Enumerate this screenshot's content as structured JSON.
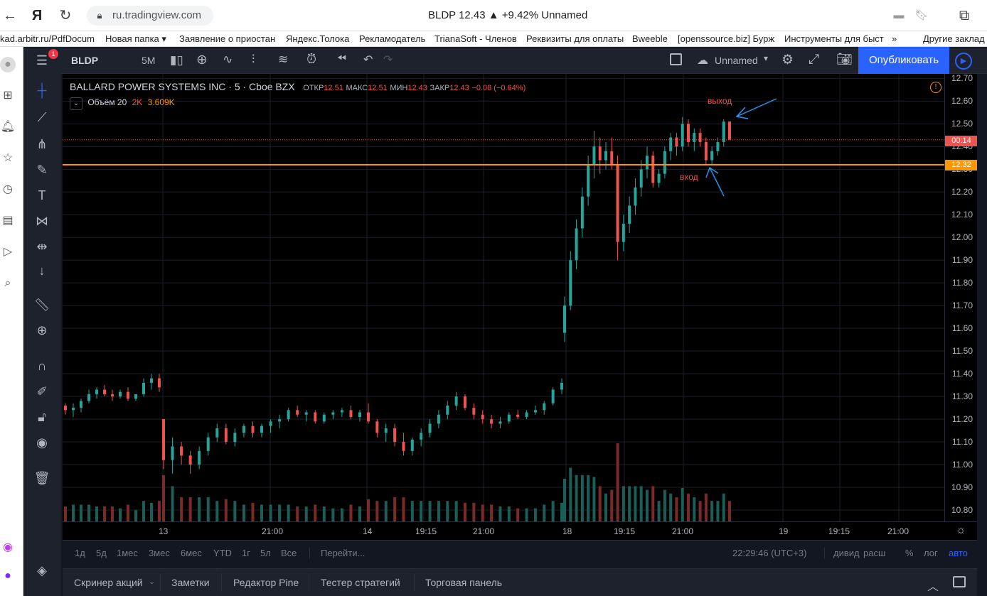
{
  "browser": {
    "url": "ru.tradingview.com",
    "title": "BLDP 12.43 ▲ +9.42% Unnamed",
    "bookmarks": [
      "kad.arbitr.ru/PdfDocum",
      "Новая папка ▾",
      "Заявление о приостан",
      "Яндекс.Толока",
      "Рекламодатель",
      "TrianaSoft - Членов",
      "Реквизиты для оплаты",
      "Bweeble",
      "[openssource.biz] Бурж",
      "Инструменты для быст",
      "»",
      "Другие заклад"
    ]
  },
  "toolbar": {
    "symbol": "BLDP",
    "interval": "5M",
    "layout_name": "Unnamed",
    "publish_label": "Опубликовать",
    "notification_count": "1"
  },
  "legend": {
    "name": "BALLARD POWER SYSTEMS INC · 5 · Cboe BZX",
    "open_label": "ОТКР",
    "open": "12.51",
    "high_label": "МАКС",
    "high": "12.51",
    "low_label": "МИН",
    "low": "12.43",
    "close_label": "ЗАКР",
    "close": "12.43",
    "change": "−0.08 (−0.64%)",
    "volume_label": "Объём 20",
    "volume_a": "2K",
    "volume_b": "3.609K"
  },
  "annotations": {
    "exit": "выход",
    "entry": "вход"
  },
  "price_axis": {
    "labels": [
      "12.70",
      "12.60",
      "12.50",
      "12.40",
      "12.30",
      "12.20",
      "12.10",
      "12.00",
      "11.90",
      "11.80",
      "11.70",
      "11.60",
      "11.50",
      "11.40",
      "11.30",
      "11.20",
      "11.10",
      "11.00",
      "10.90",
      "10.80"
    ],
    "current_price_tag": "00:14",
    "level_tag": "12.32"
  },
  "time_axis": {
    "labels": [
      "13",
      "21:00",
      "14",
      "19:15",
      "21:00",
      "18",
      "19:15",
      "21:00",
      "19",
      "19:15",
      "21:00"
    ]
  },
  "bottom_bar": {
    "ranges": [
      "1д",
      "5д",
      "1мес",
      "3мес",
      "6мес",
      "YTD",
      "1г",
      "5л",
      "Все"
    ],
    "goto": "Перейти...",
    "clock": "22:29:46 (UTC+3)",
    "options": [
      "дивид",
      "расш",
      "%",
      "лог",
      "авто"
    ]
  },
  "panel_tabs": [
    "Скринер акций",
    "Заметки",
    "Редактор Pine",
    "Тестер стратегий",
    "Торговая панель"
  ],
  "colors": {
    "up": "#26a69a",
    "down": "#ef5350",
    "level": "#ff9800",
    "accent": "#2962ff",
    "arrow": "#2196f3"
  },
  "chart_data": {
    "type": "candlestick",
    "title": "BALLARD POWER SYSTEMS INC · 5 · Cboe BZX",
    "ylim": [
      10.75,
      12.72
    ],
    "x_ticks": [
      "13",
      "21:00",
      "14",
      "19:15",
      "21:00",
      "18",
      "19:15",
      "21:00",
      "19",
      "19:15",
      "21:00"
    ],
    "horizontal_level": 12.32,
    "last_price": 12.43,
    "ohlc": [
      [
        11.26,
        11.27,
        11.22,
        11.24
      ],
      [
        11.24,
        11.27,
        11.21,
        11.25
      ],
      [
        11.25,
        11.29,
        11.23,
        11.28
      ],
      [
        11.28,
        11.33,
        11.27,
        11.31
      ],
      [
        11.31,
        11.34,
        11.29,
        11.33
      ],
      [
        11.33,
        11.35,
        11.3,
        11.31
      ],
      [
        11.31,
        11.33,
        11.28,
        11.3
      ],
      [
        11.3,
        11.33,
        11.29,
        11.32
      ],
      [
        11.32,
        11.34,
        11.28,
        11.29
      ],
      [
        11.29,
        11.31,
        11.28,
        11.31
      ],
      [
        11.31,
        11.38,
        11.3,
        11.36
      ],
      [
        11.36,
        11.4,
        11.33,
        11.38
      ],
      [
        11.38,
        11.4,
        11.32,
        11.34
      ],
      [
        11.2,
        11.2,
        10.98,
        11.02
      ],
      [
        11.02,
        11.12,
        10.96,
        11.08
      ],
      [
        11.08,
        11.1,
        11.0,
        11.04
      ],
      [
        11.04,
        11.06,
        10.96,
        11.0
      ],
      [
        11.0,
        11.08,
        10.98,
        11.06
      ],
      [
        11.06,
        11.14,
        11.04,
        11.12
      ],
      [
        11.12,
        11.18,
        11.1,
        11.16
      ],
      [
        11.16,
        11.18,
        11.09,
        11.1
      ],
      [
        11.1,
        11.16,
        11.08,
        11.14
      ],
      [
        11.14,
        11.18,
        11.12,
        11.17
      ],
      [
        11.17,
        11.19,
        11.12,
        11.14
      ],
      [
        11.14,
        11.18,
        11.12,
        11.17
      ],
      [
        11.17,
        11.2,
        11.14,
        11.19
      ],
      [
        11.19,
        11.22,
        11.16,
        11.2
      ],
      [
        11.2,
        11.25,
        11.19,
        11.24
      ],
      [
        11.24,
        11.26,
        11.21,
        11.22
      ],
      [
        11.22,
        11.24,
        11.19,
        11.23
      ],
      [
        11.23,
        11.24,
        11.18,
        11.19
      ],
      [
        11.19,
        11.23,
        11.18,
        11.22
      ],
      [
        11.22,
        11.24,
        11.2,
        11.23
      ],
      [
        11.23,
        11.25,
        11.21,
        11.24
      ],
      [
        11.24,
        11.26,
        11.2,
        11.21
      ],
      [
        11.21,
        11.24,
        11.19,
        11.23
      ],
      [
        11.23,
        11.27,
        11.18,
        11.19
      ],
      [
        11.19,
        11.2,
        11.12,
        11.14
      ],
      [
        11.14,
        11.18,
        11.1,
        11.16
      ],
      [
        11.16,
        11.18,
        11.08,
        11.1
      ],
      [
        11.1,
        11.14,
        11.04,
        11.06
      ],
      [
        11.06,
        11.12,
        11.04,
        11.11
      ],
      [
        11.11,
        11.16,
        11.08,
        11.14
      ],
      [
        11.14,
        11.2,
        11.12,
        11.18
      ],
      [
        11.18,
        11.24,
        11.16,
        11.22
      ],
      [
        11.22,
        11.28,
        11.2,
        11.26
      ],
      [
        11.26,
        11.32,
        11.24,
        11.3
      ],
      [
        11.3,
        11.31,
        11.24,
        11.25
      ],
      [
        11.25,
        11.27,
        11.2,
        11.22
      ],
      [
        11.22,
        11.24,
        11.18,
        11.2
      ],
      [
        11.2,
        11.22,
        11.16,
        11.18
      ],
      [
        11.18,
        11.21,
        11.16,
        11.19
      ],
      [
        11.19,
        11.23,
        11.18,
        11.22
      ],
      [
        11.22,
        11.24,
        11.2,
        11.21
      ],
      [
        11.21,
        11.24,
        11.2,
        11.23
      ],
      [
        11.23,
        11.26,
        11.22,
        11.24
      ],
      [
        11.24,
        11.28,
        11.22,
        11.27
      ],
      [
        11.27,
        11.34,
        11.26,
        11.33
      ],
      [
        11.33,
        11.38,
        11.31,
        11.36
      ],
      [
        11.58,
        11.74,
        11.54,
        11.7
      ],
      [
        11.7,
        11.94,
        11.68,
        11.9
      ],
      [
        11.9,
        12.08,
        11.86,
        12.04
      ],
      [
        12.04,
        12.22,
        12.0,
        12.18
      ],
      [
        12.18,
        12.36,
        12.14,
        12.32
      ],
      [
        12.32,
        12.47,
        12.26,
        12.4
      ],
      [
        12.4,
        12.44,
        12.28,
        12.34
      ],
      [
        12.34,
        12.42,
        12.3,
        12.38
      ],
      [
        12.38,
        12.44,
        12.3,
        12.32
      ],
      [
        12.32,
        12.36,
        11.9,
        11.98
      ],
      [
        11.98,
        12.1,
        11.94,
        12.06
      ],
      [
        12.06,
        12.18,
        12.02,
        12.14
      ],
      [
        12.14,
        12.26,
        12.1,
        12.22
      ],
      [
        12.22,
        12.34,
        12.18,
        12.3
      ],
      [
        12.3,
        12.4,
        12.26,
        12.36
      ],
      [
        12.36,
        12.38,
        12.22,
        12.24
      ],
      [
        12.24,
        12.3,
        12.22,
        12.28
      ],
      [
        12.28,
        12.4,
        12.26,
        12.38
      ],
      [
        12.38,
        12.46,
        12.34,
        12.44
      ],
      [
        12.44,
        12.46,
        12.36,
        12.4
      ],
      [
        12.4,
        12.53,
        12.38,
        12.5
      ],
      [
        12.5,
        12.52,
        12.4,
        12.42
      ],
      [
        12.42,
        12.48,
        12.38,
        12.46
      ],
      [
        12.46,
        12.48,
        12.4,
        12.42
      ],
      [
        12.42,
        12.44,
        12.32,
        12.34
      ],
      [
        12.34,
        12.4,
        12.32,
        12.38
      ],
      [
        12.38,
        12.44,
        12.36,
        12.42
      ],
      [
        12.42,
        12.52,
        12.4,
        12.51
      ],
      [
        12.51,
        12.51,
        12.43,
        12.43
      ]
    ]
  }
}
